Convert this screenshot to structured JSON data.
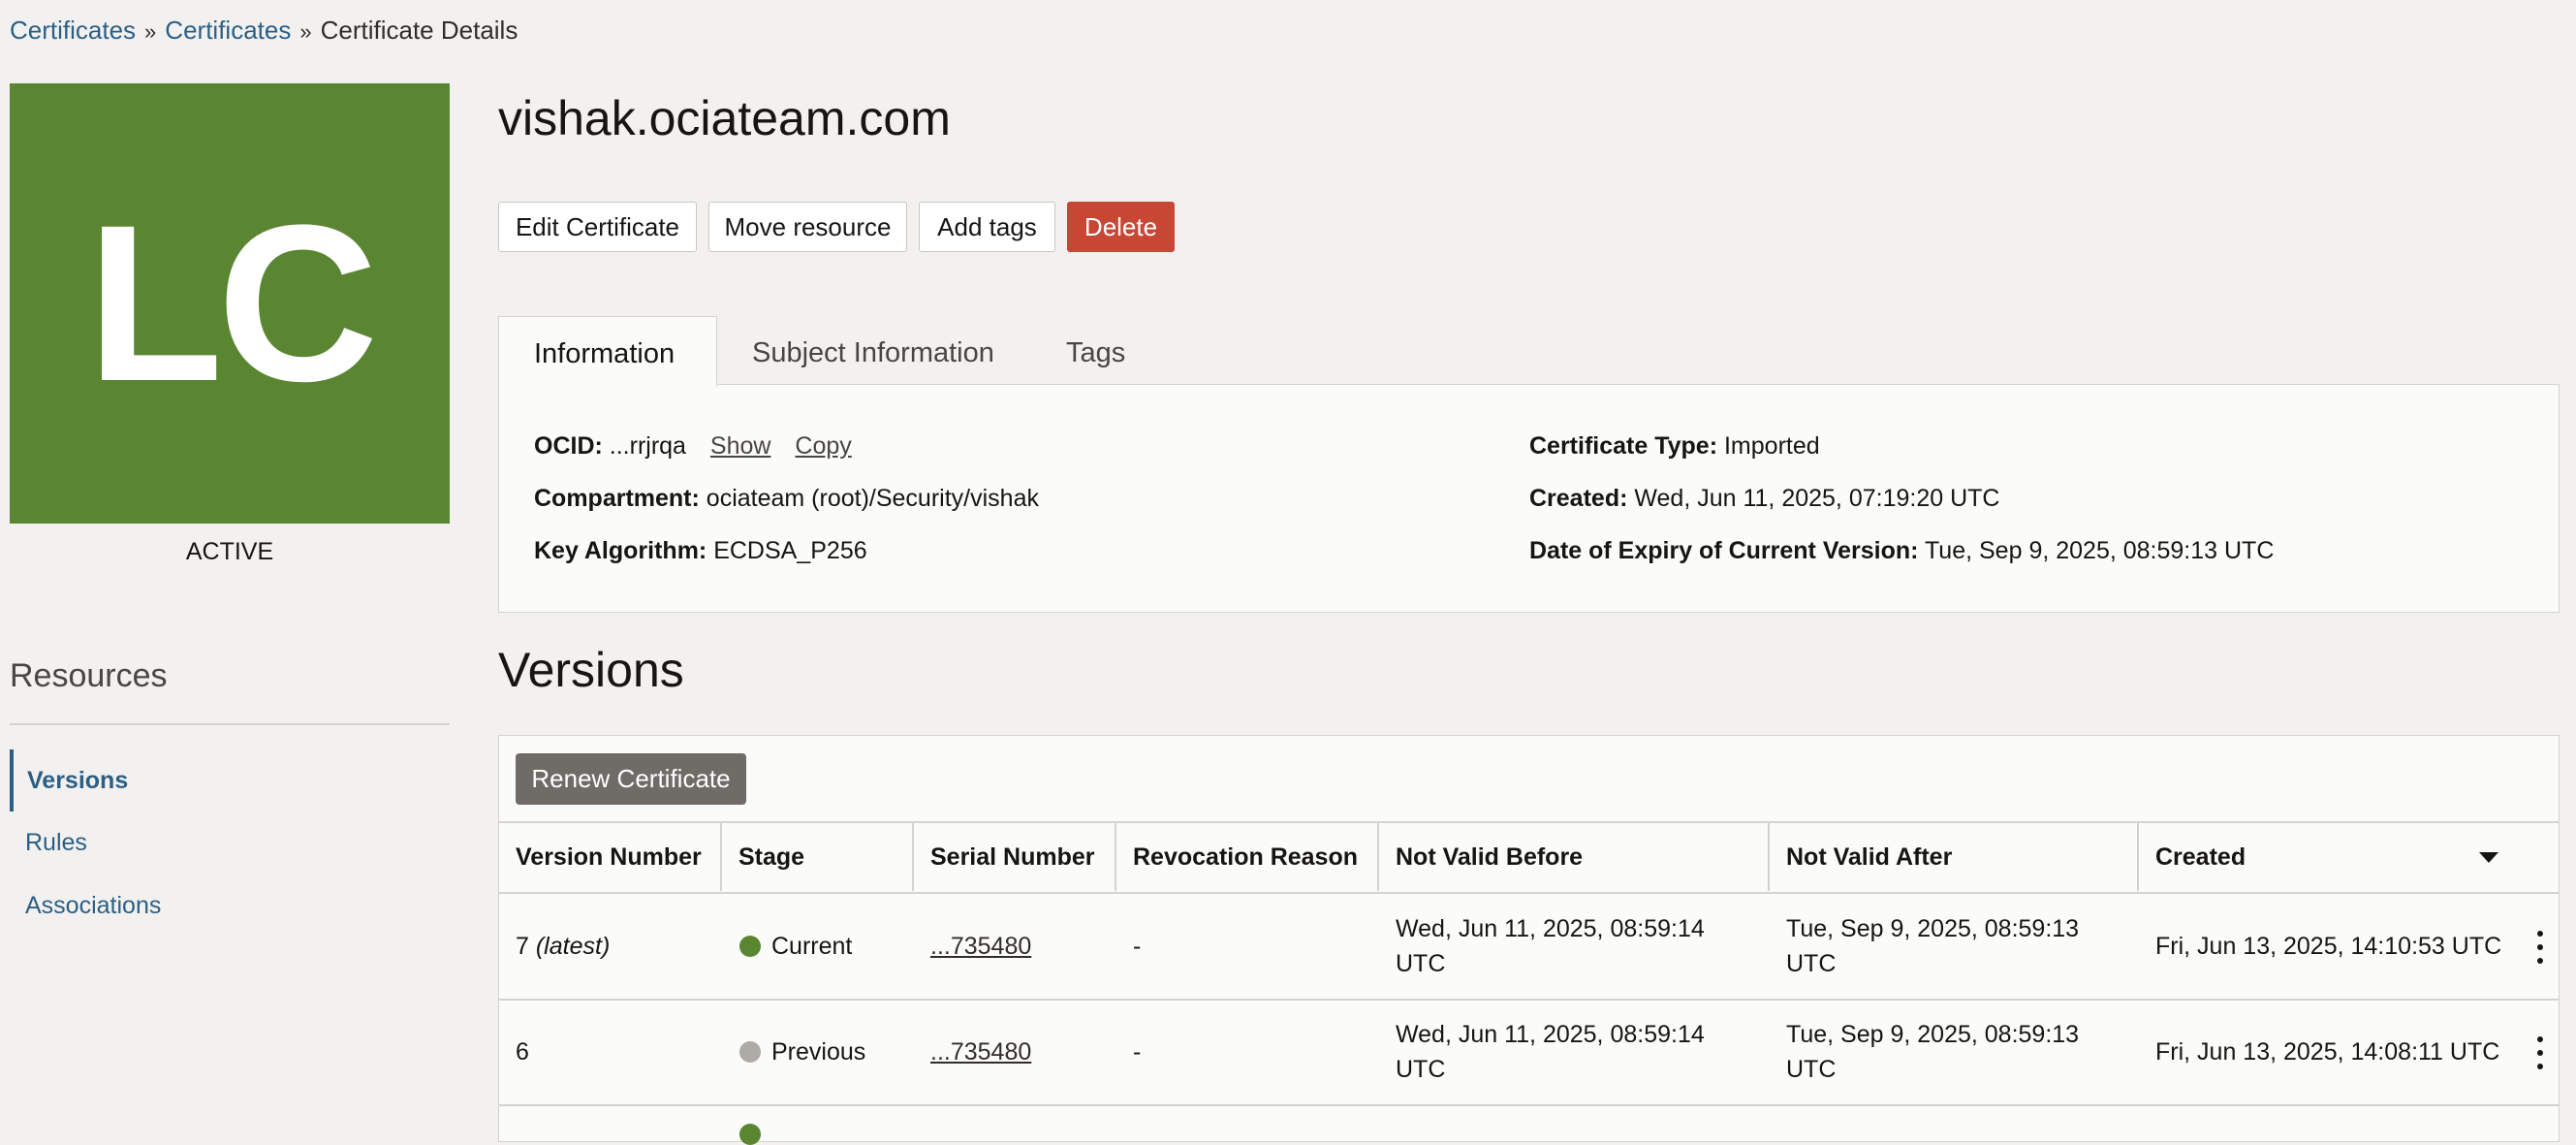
{
  "breadcrumb": {
    "items": [
      "Certificates",
      "Certificates",
      "Certificate Details"
    ],
    "separator": "»"
  },
  "resource_icon": {
    "initials": "LC",
    "color": "#5a8531"
  },
  "status": "ACTIVE",
  "resources": {
    "title": "Resources",
    "items": [
      "Versions",
      "Rules",
      "Associations"
    ],
    "active": "Versions"
  },
  "page_title": "vishak.ociateam.com",
  "actions": {
    "edit": "Edit Certificate",
    "move": "Move resource",
    "tags": "Add tags",
    "delete": "Delete"
  },
  "tabs": [
    "Information",
    "Subject Information",
    "Tags"
  ],
  "info": {
    "ocid_label": "OCID:",
    "ocid_value": "...rrjrqa",
    "show": "Show",
    "copy": "Copy",
    "compartment_label": "Compartment:",
    "compartment_value": "ociateam (root)/Security/vishak",
    "key_alg_label": "Key Algorithm:",
    "key_alg_value": "ECDSA_P256",
    "cert_type_label": "Certificate Type:",
    "cert_type_value": "Imported",
    "created_label": "Created:",
    "created_value": "Wed, Jun 11, 2025, 07:19:20 UTC",
    "expiry_label": "Date of Expiry of Current Version:",
    "expiry_value": "Tue, Sep 9, 2025, 08:59:13 UTC"
  },
  "versions": {
    "title": "Versions",
    "renew_button": "Renew Certificate",
    "columns": [
      "Version Number",
      "Stage",
      "Serial Number",
      "Revocation Reason",
      "Not Valid Before",
      "Not Valid After",
      "Created"
    ],
    "rows": [
      {
        "version": "7",
        "version_note": "(latest)",
        "stage": "Current",
        "stage_color": "#5a8531",
        "serial": "...735480",
        "revocation": "-",
        "nvb_1": "Wed, Jun 11, 2025, 08:59:14",
        "nvb_2": "UTC",
        "nva_1": "Tue, Sep 9, 2025, 08:59:13",
        "nva_2": "UTC",
        "created": "Fri, Jun 13, 2025, 14:10:53 UTC"
      },
      {
        "version": "6",
        "version_note": "",
        "stage": "Previous",
        "stage_color": "#aeaaa6",
        "serial": "...735480",
        "revocation": "-",
        "nvb_1": "Wed, Jun 11, 2025, 08:59:14",
        "nvb_2": "UTC",
        "nva_1": "Tue, Sep 9, 2025, 08:59:13",
        "nva_2": "UTC",
        "created": "Fri, Jun 13, 2025, 14:08:11 UTC"
      }
    ]
  }
}
